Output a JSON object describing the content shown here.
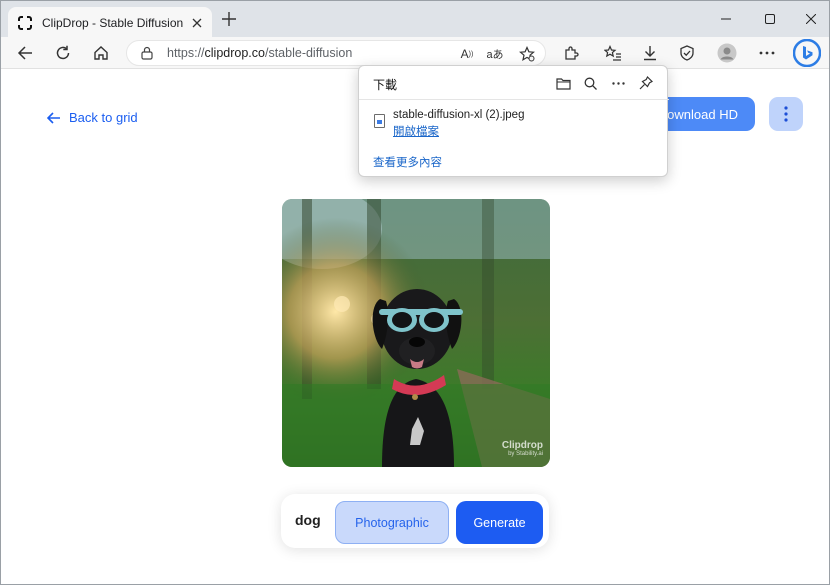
{
  "browser": {
    "tab_title": "ClipDrop - Stable Diffusion",
    "url_prefix": "https://",
    "url_domain": "clipdrop.co",
    "url_path": "/stable-diffusion",
    "read_aloud_glyph": "A",
    "translate_glyph": "aあ"
  },
  "downloads": {
    "title": "下載",
    "filename": "stable-diffusion-xl (2).jpeg",
    "open_file": "開啟檔案",
    "see_more": "查看更多內容"
  },
  "page": {
    "back_label": "Back to grid",
    "download_hd_label": "Download HD",
    "watermark_brand": "Clipdrop",
    "watermark_sub": "by Stability.ai",
    "prompt_text": "dog",
    "style_label": "Photographic",
    "generate_label": "Generate"
  },
  "colors": {
    "accent": "#1d5cf2",
    "link": "#1b5ef0",
    "style_bg": "#c9d9fb",
    "tab_bar": "#dfe3e8"
  }
}
